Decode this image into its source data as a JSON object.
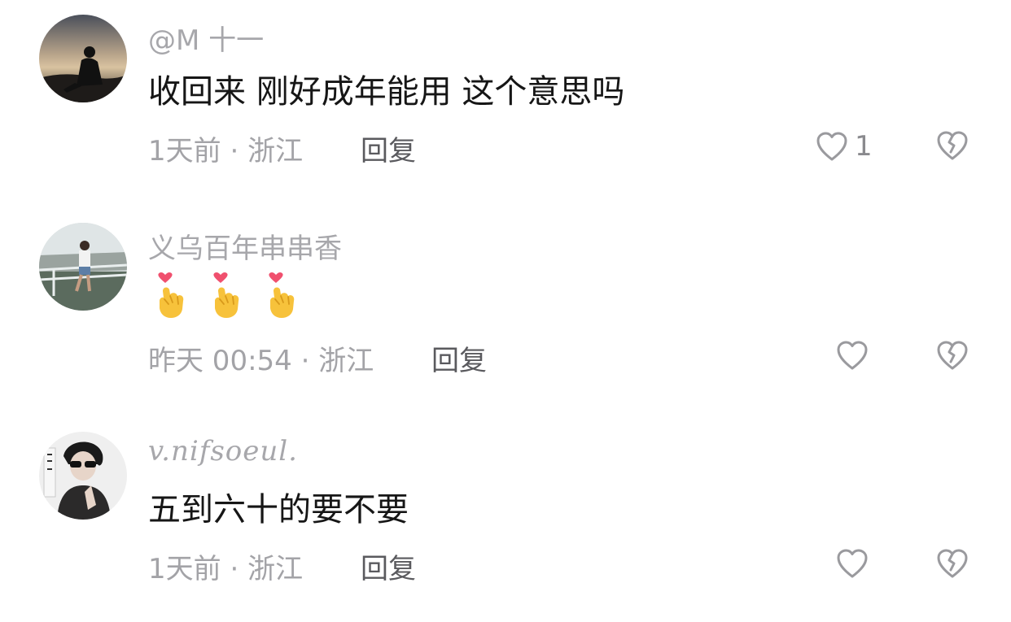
{
  "comments": [
    {
      "username": "@M 十一",
      "text": "收回来 刚好成年能用 这个意思吗",
      "time": "1天前",
      "location": "浙江",
      "reply_label": "回复",
      "likes": "1"
    },
    {
      "username": "义乌百年串串香",
      "text": "",
      "emojis": [
        "finger-heart-emoji",
        "finger-heart-emoji",
        "finger-heart-emoji"
      ],
      "time": "昨天 00:54",
      "location": "浙江",
      "reply_label": "回复",
      "likes": ""
    },
    {
      "username": "v.nifsoeul.",
      "text": "五到六十的要不要",
      "time": "1天前",
      "location": "浙江",
      "reply_label": "回复",
      "likes": ""
    }
  ],
  "meta_separator": "·",
  "colors": {
    "username": "#a7a7ab",
    "body_text": "#161616",
    "meta": "#a3a3a7",
    "reply": "#5a5a5e",
    "icon_stroke": "#9a9a9e",
    "heart_emoji": "#f0506e",
    "hand_emoji": "#f7c23b"
  }
}
